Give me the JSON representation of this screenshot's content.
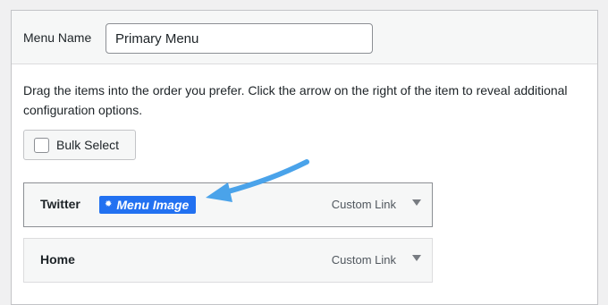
{
  "menu_name": {
    "label": "Menu Name",
    "value": "Primary Menu"
  },
  "instructions": "Drag the items into the order you prefer. Click the arrow on the right of the item to reveal additional configuration options.",
  "bulk_select": {
    "label": "Bulk Select",
    "checked": false
  },
  "menu_items": [
    {
      "title": "Twitter",
      "badge": {
        "icon": "gear-icon",
        "label": "Menu Image"
      },
      "type": "Custom Link"
    },
    {
      "title": "Home",
      "type": "Custom Link"
    }
  ],
  "colors": {
    "badge": "#2271f1",
    "annotation_arrow": "#4aa3ea"
  }
}
